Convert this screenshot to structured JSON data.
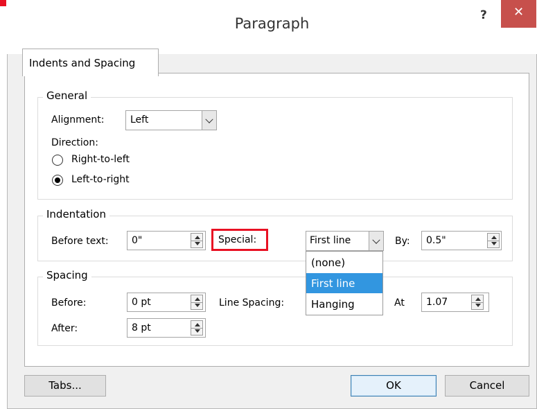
{
  "window": {
    "title": "Paragraph",
    "help_label": "?",
    "close_label": "✕"
  },
  "tab": {
    "label": "Indents and Spacing"
  },
  "general": {
    "label": "General",
    "alignment_label": "Alignment:",
    "alignment_value": "Left",
    "direction_label": "Direction:",
    "rtl_label": "Right-to-left",
    "ltr_label": "Left-to-right",
    "selected_direction": "Left-to-right"
  },
  "indentation": {
    "label": "Indentation",
    "before_text_label": "Before text:",
    "before_text_value": "0\"",
    "special_label": "Special:",
    "special_value": "First line",
    "by_label": "By:",
    "by_value": "0.5\"",
    "special_options": [
      "(none)",
      "First line",
      "Hanging"
    ],
    "selected_option": "First line"
  },
  "spacing": {
    "label": "Spacing",
    "before_label": "Before:",
    "before_value": "0 pt",
    "after_label": "After:",
    "after_value": "8 pt",
    "line_spacing_label": "Line Spacing:",
    "at_label": "At",
    "at_value": "1.07"
  },
  "footer": {
    "tabs_label": "Tabs...",
    "ok_label": "OK",
    "cancel_label": "Cancel"
  },
  "colors": {
    "close": "#c7504c",
    "highlight": "#e81123",
    "selection": "#3296e0"
  }
}
